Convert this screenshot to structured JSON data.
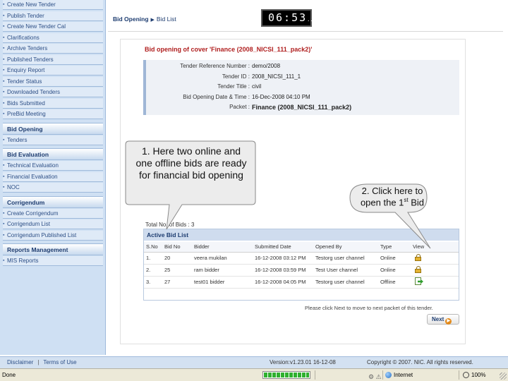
{
  "sidebar": {
    "top_items": [
      "Create New Tender",
      "Publish Tender",
      "Create New Tender Cal",
      "Clarifications",
      "Archive Tenders",
      "Published Tenders",
      "Enquiry Report",
      "Tender Status",
      "Downloaded Tenders",
      "Bids Submitted",
      "PreBid Meeting"
    ],
    "sections": [
      {
        "title": "Bid Opening",
        "items": [
          "Tenders"
        ]
      },
      {
        "title": "Bid Evaluation",
        "items": [
          "Technical Evaluation",
          "Financial Evaluation",
          "NOC"
        ]
      },
      {
        "title": "Corrigendum",
        "items": [
          "Create Corrigendum",
          "Corrigendum List",
          "Corrigendum Published List"
        ]
      },
      {
        "title": "Reports Management",
        "items": [
          "MIS Reports"
        ]
      }
    ]
  },
  "header": {
    "breadcrumb_current": "Bid Opening",
    "breadcrumb_link": "Bid List",
    "clock": "06:53",
    "clock_suffix": "..."
  },
  "cover": {
    "title": "Bid opening of cover 'Finance (2008_NICSI_111_pack2)'",
    "fields": [
      {
        "label": "Tender Reference Number :",
        "value": "demo/2008"
      },
      {
        "label": "Tender ID :",
        "value": "2008_NICSI_111_1"
      },
      {
        "label": "Tender Title :",
        "value": "civil"
      },
      {
        "label": "Bid Opening Date & Time :",
        "value": "16-Dec-2008 04:10 PM"
      },
      {
        "label": "Packet :",
        "value": "Finance (2008_NICSI_111_pack2)"
      }
    ]
  },
  "bids": {
    "total_label": "Total No. of Bids :",
    "total_value": "3",
    "panel_title": "Active Bid List",
    "columns": [
      "S.No",
      "Bid No",
      "Bidder",
      "Submitted Date",
      "Opened By",
      "Type",
      "View"
    ],
    "rows": [
      {
        "sno": "1.",
        "bid_no": "20",
        "bidder": "veera mukilan",
        "date": "16-12-2008 03:12 PM",
        "opened_by": "Testorg user channel",
        "type": "Online",
        "view": "lock-icon"
      },
      {
        "sno": "2.",
        "bid_no": "25",
        "bidder": "ram bidder",
        "date": "16-12-2008 03:59 PM",
        "opened_by": "Test User channel",
        "type": "Online",
        "view": "lock-icon"
      },
      {
        "sno": "3.",
        "bid_no": "27",
        "bidder": "test01 bidder",
        "date": "16-12-2008 04:05 PM",
        "opened_by": "Testorg user channel",
        "type": "Offline",
        "view": "open-doc-icon"
      }
    ]
  },
  "hint": "Please click Next to move to next packet of this tender.",
  "next_label": "Next",
  "footer": {
    "disclaimer": "Disclaimer",
    "terms": "Terms of Use",
    "version": "Version:v1.23.01 16-12-08",
    "copyright": "Copyright © 2007. NIC. All rights reserved."
  },
  "status": {
    "text": "Done",
    "zone": "Internet",
    "zoom": "100%",
    "progress_fraction": 1.0
  },
  "callouts": {
    "one": "1. Here two online and one offline bids are ready for financial bid opening",
    "two_prefix": "2. Click here to open the 1",
    "two_sup": "st",
    "two_suffix": " Bid"
  }
}
